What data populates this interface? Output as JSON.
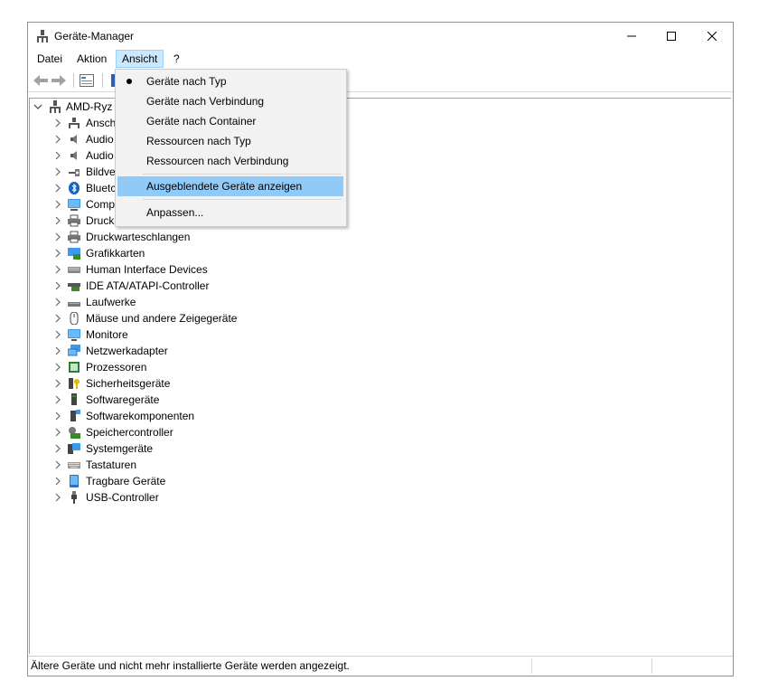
{
  "window": {
    "title": "Geräte-Manager"
  },
  "menubar": {
    "items": [
      "Datei",
      "Aktion",
      "Ansicht",
      "?"
    ]
  },
  "dropdown": {
    "items": [
      "Geräte nach Typ",
      "Geräte nach Verbindung",
      "Geräte nach Container",
      "Ressourcen nach Typ",
      "Ressourcen nach Verbindung",
      "Ausgeblendete Geräte anzeigen",
      "Anpassen..."
    ],
    "checked_item": "Geräte nach Typ",
    "highlighted_item": "Ausgeblendete Geräte anzeigen"
  },
  "tree": {
    "root": "AMD-Ryz",
    "items": [
      "Ansch",
      "Audio",
      "Audio",
      "Bildve",
      "Bluetc",
      "Comp",
      "Druck",
      "Druckwarteschlangen",
      "Grafikkarten",
      "Human Interface Devices",
      "IDE ATA/ATAPI-Controller",
      "Laufwerke",
      "Mäuse und andere Zeigegeräte",
      "Monitore",
      "Netzwerkadapter",
      "Prozessoren",
      "Sicherheitsgeräte",
      "Softwaregeräte",
      "Softwarekomponenten",
      "Speichercontroller",
      "Systemgeräte",
      "Tastaturen",
      "Tragbare Geräte",
      "USB-Controller"
    ]
  },
  "statusbar": {
    "text": "Ältere Geräte und nicht mehr installierte Geräte werden angezeigt."
  },
  "colors": {
    "menu_active_bg": "#cce8ff",
    "dropdown_highlight": "#91c9f7",
    "dropdown_bg": "#f2f2f2"
  }
}
